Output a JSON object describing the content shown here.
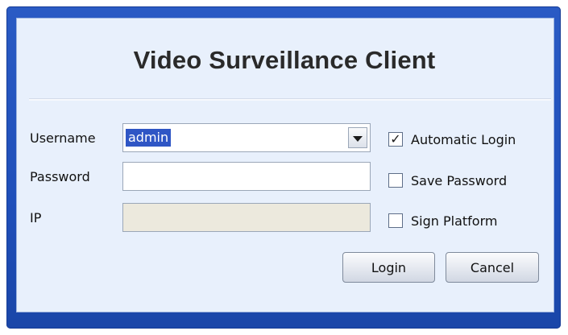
{
  "window": {
    "title": "Video Surveillance Client"
  },
  "form": {
    "username": {
      "label": "Username",
      "value": "admin"
    },
    "password": {
      "label": "Password",
      "value": ""
    },
    "ip": {
      "label": "IP",
      "value": ""
    }
  },
  "options": {
    "automatic_login": {
      "label": "Automatic Login",
      "checked": true,
      "check_mark": "✓"
    },
    "save_password": {
      "label": "Save Password",
      "checked": false
    },
    "sign_platform": {
      "label": "Sign Platform",
      "checked": false
    }
  },
  "buttons": {
    "login": "Login",
    "cancel": "Cancel"
  },
  "colors": {
    "window_frame": "#1f4fba",
    "panel_background": "#e8f0fc",
    "selection": "#2f56c5",
    "disabled_field": "#ece9dd"
  },
  "icons": {
    "dropdown": "chevron-down-icon",
    "checkbox": "checkbox-icon"
  }
}
